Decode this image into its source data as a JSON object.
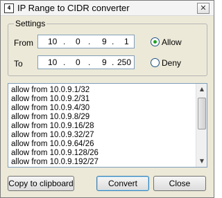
{
  "window": {
    "icon_text": "4",
    "title": "IP Range to CIDR converter",
    "close_glyph": "✕"
  },
  "settings": {
    "legend": "Settings",
    "from": {
      "label": "From",
      "octets": [
        "10",
        "0",
        "9",
        "1"
      ]
    },
    "to": {
      "label": "To",
      "octets": [
        "10",
        "0",
        "9",
        "250"
      ]
    },
    "dot": ".",
    "mode": {
      "selected": "Allow",
      "options": [
        "Allow",
        "Deny"
      ]
    }
  },
  "output": {
    "lines": [
      "allow from 10.0.9.1/32",
      "allow from 10.0.9.2/31",
      "allow from 10.0.9.4/30",
      "allow from 10.0.9.8/29",
      "allow from 10.0.9.16/28",
      "allow from 10.0.9.32/27",
      "allow from 10.0.9.64/26",
      "allow from 10.0.9.128/26",
      "allow from 10.0.9.192/27"
    ],
    "scroll_up_glyph": "▲",
    "scroll_down_glyph": "▼"
  },
  "buttons": {
    "copy": "Copy to clipboard",
    "convert": "Convert",
    "close": "Close"
  },
  "colors": {
    "window_bg": "#ece9d8",
    "field_border": "#7f9db9",
    "radio_dot": "#21a121"
  }
}
